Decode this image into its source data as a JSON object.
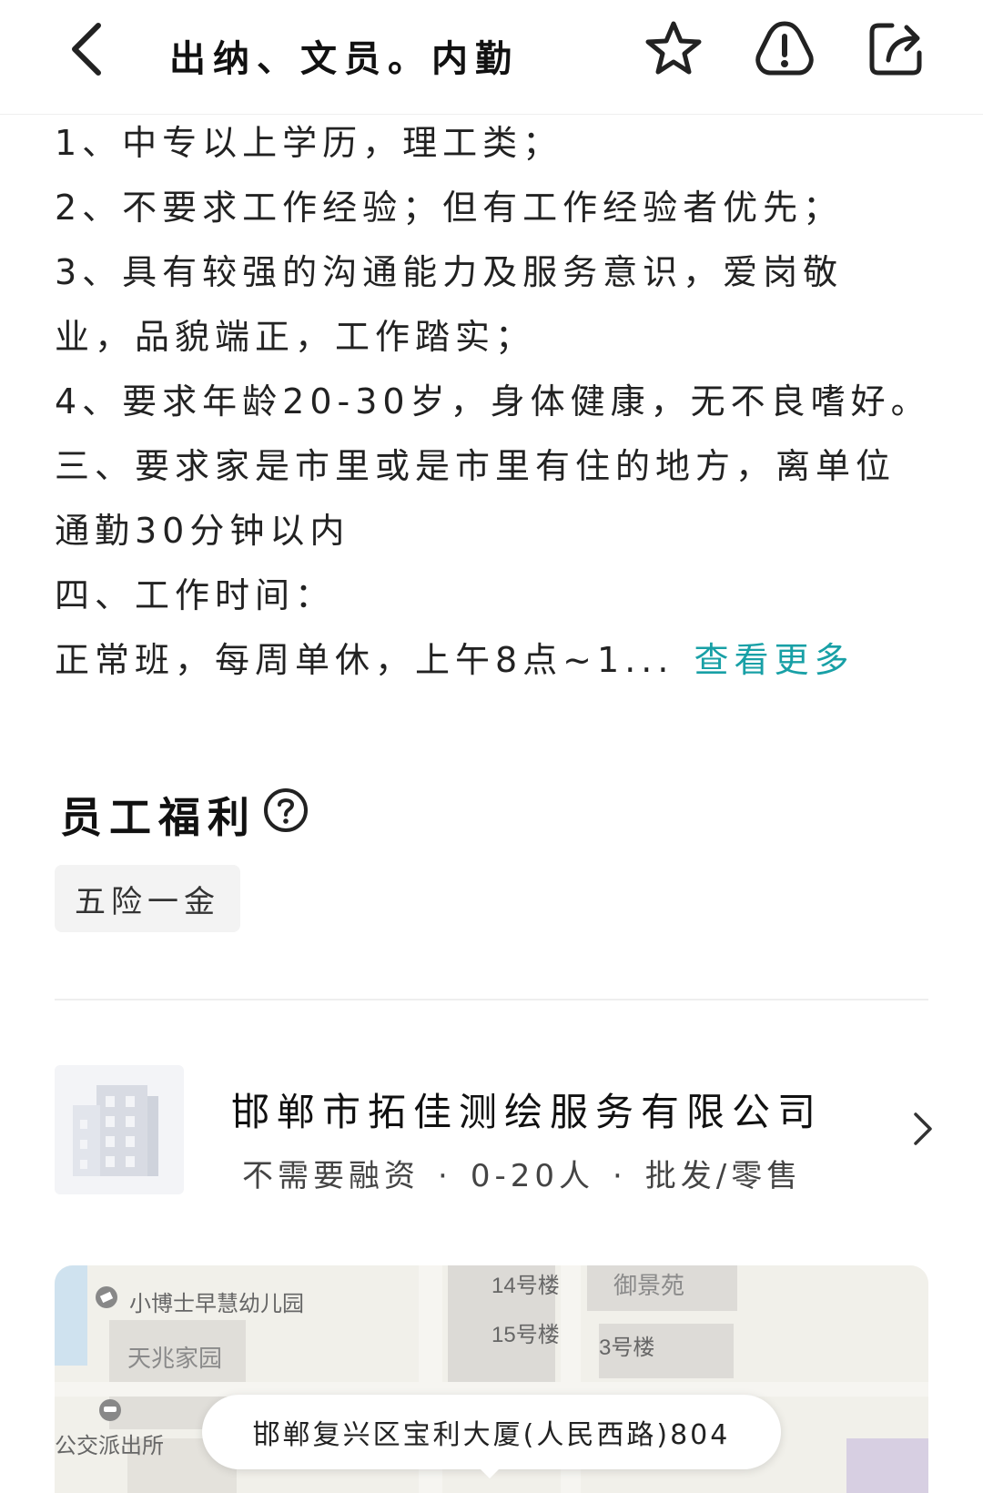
{
  "header": {
    "title": "出纳、文员。内勤",
    "icons": {
      "back": "chevron-left-icon",
      "favorite": "star-icon",
      "report": "alert-icon",
      "share": "share-icon"
    }
  },
  "description": {
    "lines": [
      "1、中专以上学历，理工类；",
      "2、不要求工作经验；但有工作经验者优先；",
      "3、具有较强的沟通能力及服务意识，爱岗敬",
      "业，品貌端正，工作踏实；",
      "4、要求年龄20-30岁，身体健康，无不良嗜好。",
      "三、要求家是市里或是市里有住的地方，离单位",
      "通勤30分钟以内",
      "四、工作时间：",
      "正常班，每周单休，上午8点~1..."
    ],
    "more_link": "查看更多",
    "link_color": "#18a0a6"
  },
  "benefits": {
    "title": "员工福利",
    "tags": [
      "五险一金"
    ]
  },
  "company": {
    "name": "邯郸市拓佳测绘服务有限公司",
    "meta": [
      "不需要融资",
      "0-20人",
      "批发/零售"
    ],
    "meta_separator": "·"
  },
  "map": {
    "labels": {
      "kindergarten": "小博士早慧幼儿园",
      "tianzhao": "天兆家园",
      "police": "公交派出所",
      "building14": "14号楼",
      "building15": "15号楼",
      "building3": "3号楼",
      "yujing": "御景苑"
    },
    "address": "邯郸复兴区宝利大厦(人民西路)804"
  }
}
